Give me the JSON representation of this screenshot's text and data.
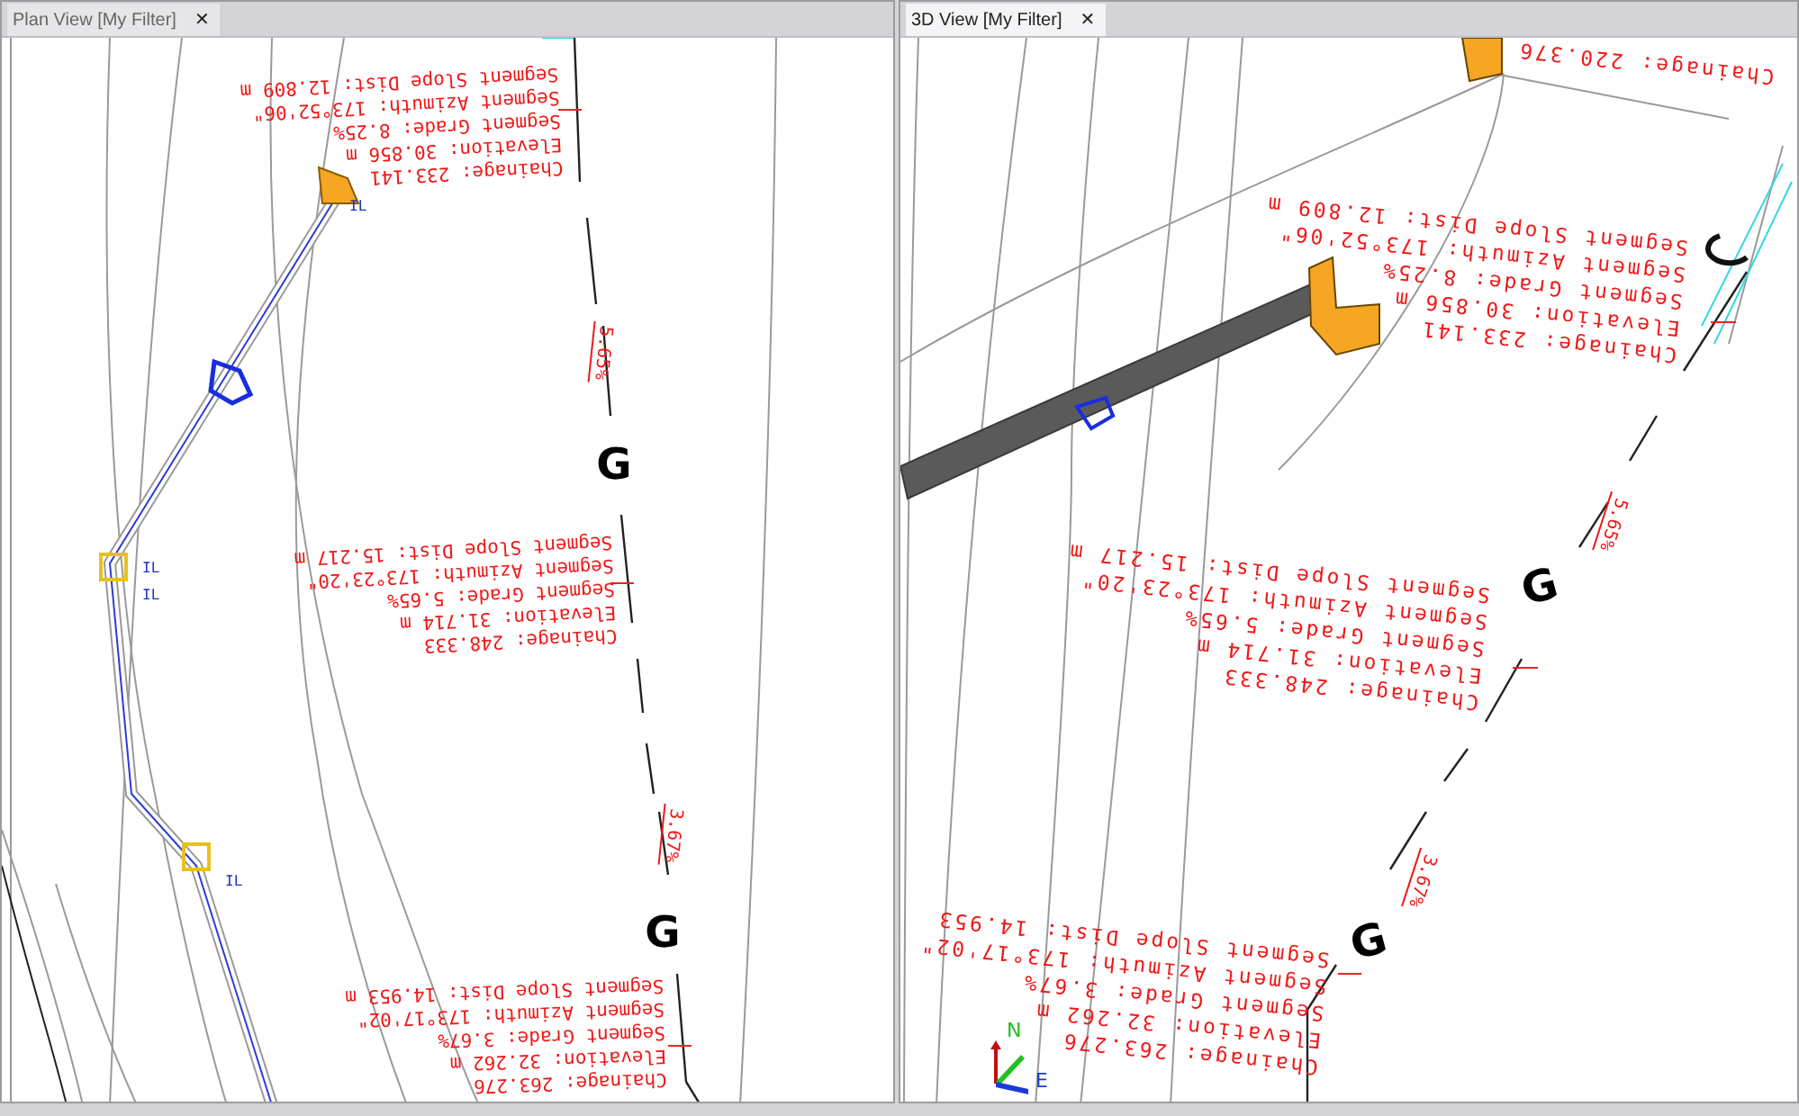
{
  "panes": [
    {
      "tab": {
        "label": "Plan View [My Filter]",
        "close": "✕",
        "selected": false
      },
      "annotations": [
        {
          "lines": [
            "Chainage: 233.141",
            "Elevation: 30.856 m",
            "Segment Grade: 8.25%",
            "Segment Azimuth: 173°52'06\"",
            "Segment Slope Dist: 12.809 m"
          ]
        },
        {
          "lines": [
            "Chainage: 248.333",
            "Elevation: 31.714 m",
            "Segment Grade: 5.65%",
            "Segment Azimuth: 173°23'20\"",
            "Segment Slope Dist: 15.217 m"
          ]
        },
        {
          "lines": [
            "Chainage: 263.276",
            "Elevation: 32.262 m",
            "Segment Grade: 3.67%",
            "Segment Azimuth: 173°17'02\"",
            "Segment Slope Dist: 14.953 m"
          ]
        }
      ],
      "grades": [
        "5.65%",
        "3.67%"
      ],
      "markers": [
        "G",
        "G"
      ],
      "invert_labels": [
        "IL",
        "IL",
        "IL",
        "IL"
      ]
    },
    {
      "tab": {
        "label": "3D View [My Filter]",
        "close": "✕",
        "selected": true
      },
      "annotations": [
        {
          "lines": [
            "Chainage: 220.376"
          ]
        },
        {
          "lines": [
            "Chainage: 233.141",
            "Elevation: 30.856 m",
            "Segment Grade: 8.25%",
            "Segment Azimuth: 173°52'06\"",
            "Segment Slope Dist: 12.809 m"
          ]
        },
        {
          "lines": [
            "Chainage: 248.333",
            "Elevation: 31.714 m",
            "Segment Grade: 5.65%",
            "Segment Azimuth: 173°23'20\"",
            "Segment Slope Dist: 15.217 m"
          ]
        },
        {
          "lines": [
            "Chainage: 263.276",
            "Elevation: 32.262 m",
            "Segment Grade: 3.67%",
            "Segment Azimuth: 173°17'02\"",
            "Segment Slope Dist: 14.953"
          ]
        }
      ],
      "grades": [
        "5.65%",
        "3.67%"
      ],
      "markers": [
        "G",
        "G"
      ],
      "compass": {
        "north": "N",
        "east": "E"
      }
    }
  ]
}
